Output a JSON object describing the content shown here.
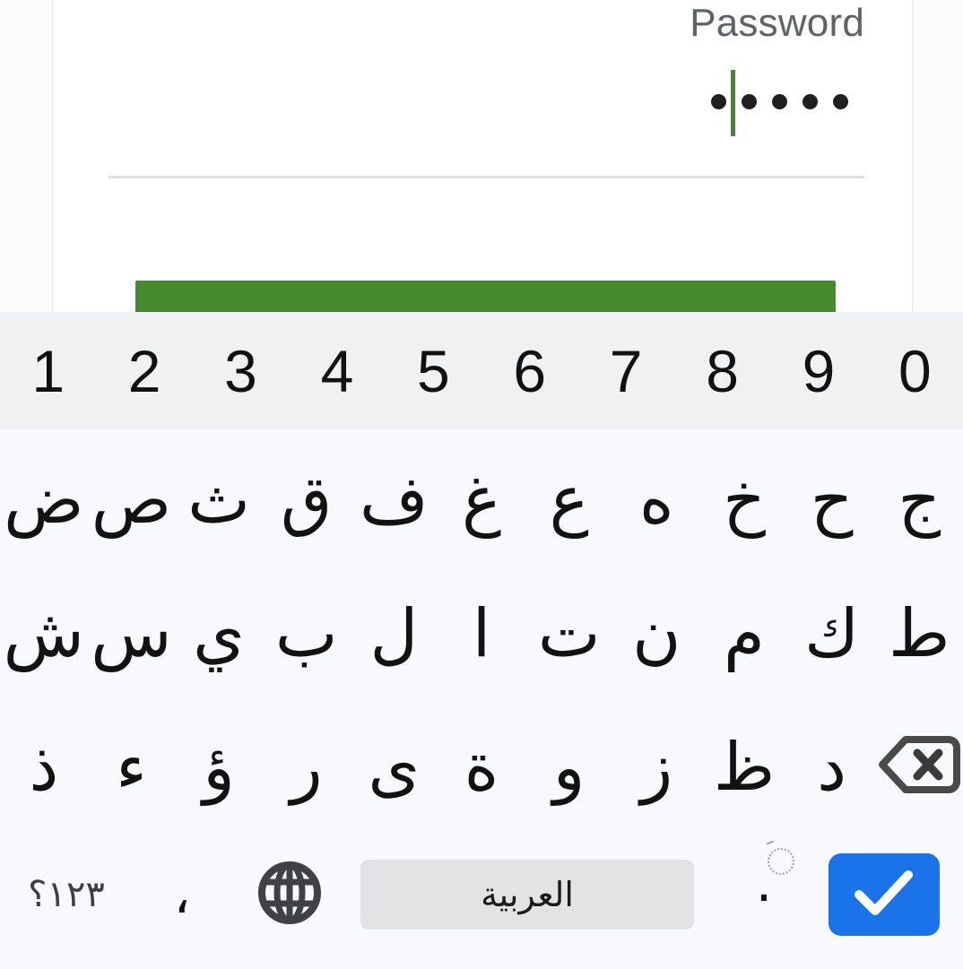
{
  "app": {
    "field": {
      "label": "Password",
      "masked_dots": 5,
      "value_is_masked": true,
      "caret_color": "#3f8b32"
    },
    "primary_button": {
      "label": "",
      "color": "#458b2e"
    }
  },
  "keyboard": {
    "language": "Arabic",
    "number_row": [
      "1",
      "2",
      "3",
      "4",
      "5",
      "6",
      "7",
      "8",
      "9",
      "0"
    ],
    "rows": [
      [
        "ض",
        "ص",
        "ث",
        "ق",
        "ف",
        "غ",
        "ع",
        "ه",
        "خ",
        "ح",
        "ج"
      ],
      [
        "ش",
        "س",
        "ي",
        "ب",
        "ل",
        "ا",
        "ت",
        "ن",
        "م",
        "ك",
        "ط"
      ],
      [
        "ذ",
        "ء",
        "ؤ",
        "ر",
        "ى",
        "ة",
        "و",
        "ز",
        "ظ",
        "د"
      ]
    ],
    "backspace_icon": "backspace-icon",
    "bottom_row": {
      "symbols_label": "١٢٣؟",
      "comma_label": "،",
      "globe_icon": "globe-icon",
      "space_label": "العربية",
      "period_label": ".",
      "enter_icon": "check-icon"
    },
    "colors": {
      "number_row_bg": "#f0f1f3",
      "keyboard_bg": "#f7f9fc",
      "spacebar_bg": "#e3e3e5",
      "enter_bg": "#1a73e8",
      "key_text": "#121212"
    }
  }
}
